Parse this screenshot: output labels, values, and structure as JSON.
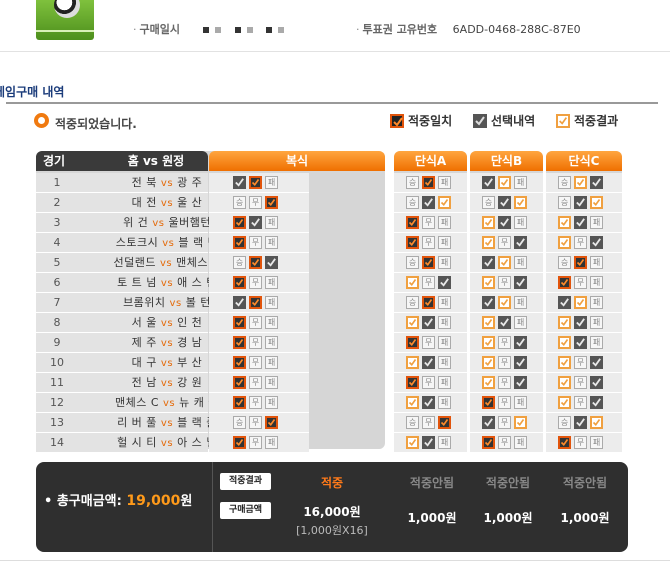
{
  "header": {
    "purchase_label": "구매일시",
    "ticket_label": "투표권 고유번호",
    "ticket_id": "6ADD-0468-288C-87E0"
  },
  "section": {
    "title": "게임구매 내역",
    "status": "적중되었습니다."
  },
  "legend": {
    "hit": "적중일치",
    "selected": "선택내역",
    "result": "적중결과"
  },
  "columns": {
    "game": "경기",
    "home": "홈",
    "vs": "vs",
    "away": "원정",
    "combo": "복식",
    "single_a": "단식A",
    "single_b": "단식B",
    "single_c": "단식C"
  },
  "option_labels": {
    "win": "승",
    "draw": "무",
    "lose": "패"
  },
  "matches": [
    {
      "no": "1",
      "home": "전 북",
      "away": "광 주",
      "combo": [
        "sel",
        "hit",
        "no"
      ],
      "a": [
        "no",
        "hit",
        "no"
      ],
      "b": [
        "sel",
        "res",
        "no"
      ],
      "c": [
        "no",
        "res",
        "sel"
      ]
    },
    {
      "no": "2",
      "home": "대 전",
      "away": "울 산",
      "combo": [
        "no",
        "no",
        "hit"
      ],
      "a": [
        "no",
        "sel",
        "res"
      ],
      "b": [
        "no",
        "sel",
        "res"
      ],
      "c": [
        "no",
        "sel",
        "res"
      ]
    },
    {
      "no": "3",
      "home": "위 건",
      "away": "울버햄턴",
      "combo": [
        "hit",
        "sel",
        "no"
      ],
      "a": [
        "hit",
        "no",
        "no"
      ],
      "b": [
        "res",
        "sel",
        "no"
      ],
      "c": [
        "res",
        "sel",
        "no"
      ]
    },
    {
      "no": "4",
      "home": "스토크시",
      "away": "블 랙 번",
      "combo": [
        "hit",
        "no",
        "no"
      ],
      "a": [
        "hit",
        "no",
        "no"
      ],
      "b": [
        "res",
        "no",
        "sel"
      ],
      "c": [
        "res",
        "no",
        "sel"
      ]
    },
    {
      "no": "5",
      "home": "선덜랜드",
      "away": "맨체스 U",
      "combo": [
        "no",
        "hit",
        "sel"
      ],
      "a": [
        "no",
        "hit",
        "no"
      ],
      "b": [
        "sel",
        "res",
        "no"
      ],
      "c": [
        "no",
        "hit",
        "no"
      ]
    },
    {
      "no": "6",
      "home": "토 트 넘",
      "away": "애 스 턴",
      "combo": [
        "hit",
        "no",
        "no"
      ],
      "a": [
        "res",
        "no",
        "sel"
      ],
      "b": [
        "res",
        "no",
        "sel"
      ],
      "c": [
        "hit",
        "no",
        "no"
      ]
    },
    {
      "no": "7",
      "home": "브롬위치",
      "away": "볼 턴",
      "combo": [
        "sel",
        "hit",
        "no"
      ],
      "a": [
        "no",
        "hit",
        "no"
      ],
      "b": [
        "sel",
        "res",
        "no"
      ],
      "c": [
        "sel",
        "res",
        "no"
      ]
    },
    {
      "no": "8",
      "home": "서 울",
      "away": "인 천",
      "combo": [
        "hit",
        "no",
        "no"
      ],
      "a": [
        "res",
        "sel",
        "no"
      ],
      "b": [
        "res",
        "sel",
        "no"
      ],
      "c": [
        "res",
        "sel",
        "no"
      ]
    },
    {
      "no": "9",
      "home": "제 주",
      "away": "경 남",
      "combo": [
        "hit",
        "no",
        "no"
      ],
      "a": [
        "hit",
        "no",
        "no"
      ],
      "b": [
        "res",
        "no",
        "sel"
      ],
      "c": [
        "res",
        "sel",
        "no"
      ]
    },
    {
      "no": "10",
      "home": "대 구",
      "away": "부 산",
      "combo": [
        "hit",
        "no",
        "no"
      ],
      "a": [
        "res",
        "sel",
        "no"
      ],
      "b": [
        "res",
        "no",
        "sel"
      ],
      "c": [
        "res",
        "no",
        "sel"
      ]
    },
    {
      "no": "11",
      "home": "전 남",
      "away": "강 원",
      "combo": [
        "hit",
        "no",
        "no"
      ],
      "a": [
        "hit",
        "no",
        "no"
      ],
      "b": [
        "res",
        "no",
        "sel"
      ],
      "c": [
        "res",
        "no",
        "sel"
      ]
    },
    {
      "no": "12",
      "home": "맨체스 C",
      "away": "뉴 캐 슬",
      "combo": [
        "hit",
        "no",
        "no"
      ],
      "a": [
        "res",
        "sel",
        "no"
      ],
      "b": [
        "hit",
        "no",
        "no"
      ],
      "c": [
        "res",
        "no",
        "sel"
      ]
    },
    {
      "no": "13",
      "home": "리 버 풀",
      "away": "블 랙 풀",
      "combo": [
        "no",
        "no",
        "hit"
      ],
      "a": [
        "no",
        "no",
        "hit"
      ],
      "b": [
        "sel",
        "no",
        "res"
      ],
      "c": [
        "no",
        "sel",
        "res"
      ]
    },
    {
      "no": "14",
      "home": "헐 시 티",
      "away": "아 스 널",
      "combo": [
        "hit",
        "no",
        "no"
      ],
      "a": [
        "res",
        "sel",
        "no"
      ],
      "b": [
        "hit",
        "no",
        "no"
      ],
      "c": [
        "hit",
        "no",
        "no"
      ]
    }
  ],
  "summary": {
    "total_label": "• 총구매금액:",
    "total_amount": "19,000",
    "total_unit": "원",
    "tag_result": "적중결과",
    "tag_purchase": "구매금액",
    "cols": [
      {
        "status": "적중",
        "amount": "16,000원",
        "sub": "[1,000원X16]"
      },
      {
        "status": "적중안됨",
        "amount": "1,000원",
        "sub": ""
      },
      {
        "status": "적중안됨",
        "amount": "1,000원",
        "sub": ""
      },
      {
        "status": "적중안됨",
        "amount": "1,000원",
        "sub": ""
      }
    ]
  },
  "colors": {
    "accent_orange": "#ef6f00",
    "hit_border": "#e1540b",
    "header_dark": "#3a3a3a",
    "summary_bg": "#2f2f2f",
    "summary_amount": "#ff9a1a"
  }
}
